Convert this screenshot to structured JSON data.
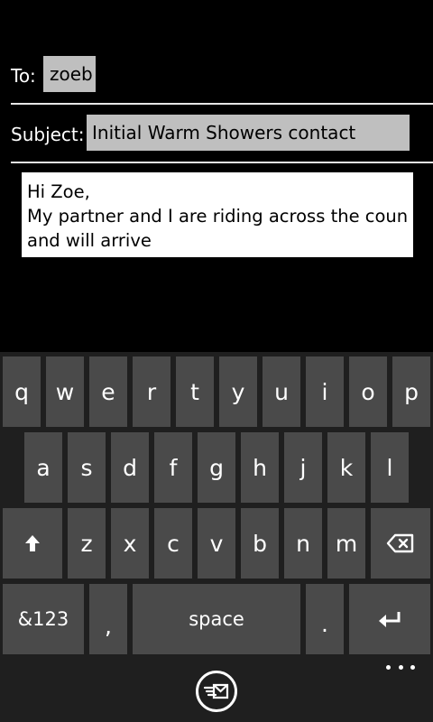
{
  "compose": {
    "to_label": "To:",
    "to_recipient": "zoeb",
    "subject_label": "Subject:",
    "subject_value": "Initial Warm Showers contact",
    "body_lines": [
      "Hi Zoe,",
      "My partner and I are riding across the country",
      "and will arrive"
    ]
  },
  "keyboard": {
    "row1": [
      "q",
      "w",
      "e",
      "r",
      "t",
      "y",
      "u",
      "i",
      "o",
      "p"
    ],
    "row2": [
      "a",
      "s",
      "d",
      "f",
      "g",
      "h",
      "j",
      "k",
      "l"
    ],
    "row3": [
      "z",
      "x",
      "c",
      "v",
      "b",
      "n",
      "m"
    ],
    "symbols_label": "&123",
    "comma_label": ",",
    "space_label": "space",
    "period_label": ".",
    "shift_icon": "shift-arrow-icon",
    "backspace_icon": "backspace-icon",
    "enter_icon": "enter-icon"
  },
  "app_bar": {
    "send_icon": "send-icon",
    "more_icon": "more-dots-icon"
  }
}
